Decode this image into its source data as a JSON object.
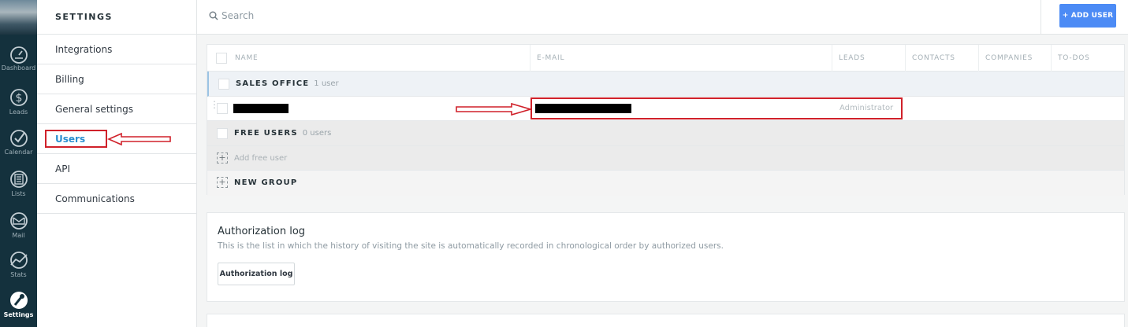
{
  "rail": {
    "items": [
      {
        "label": "Dashboard",
        "icon": "dashboard-icon"
      },
      {
        "label": "Leads",
        "icon": "dollar-icon"
      },
      {
        "label": "Calendar",
        "icon": "check-circle-icon"
      },
      {
        "label": "Lists",
        "icon": "list-icon"
      },
      {
        "label": "Mail",
        "icon": "mail-icon"
      },
      {
        "label": "Stats",
        "icon": "stats-icon"
      },
      {
        "label": "Settings",
        "icon": "wrench-icon"
      }
    ]
  },
  "settings": {
    "header": "SETTINGS",
    "items": [
      {
        "label": "Integrations"
      },
      {
        "label": "Billing"
      },
      {
        "label": "General settings"
      },
      {
        "label": "Users"
      },
      {
        "label": "API"
      },
      {
        "label": "Communications"
      }
    ]
  },
  "topbar": {
    "search_placeholder": "Search",
    "add_user_label": "+ ADD USER"
  },
  "table": {
    "columns": [
      "NAME",
      "E-MAIL",
      "LEADS",
      "CONTACTS",
      "COMPANIES",
      "TO-DOS"
    ],
    "group1": {
      "name": "SALES OFFICE",
      "count": "1 user"
    },
    "user_row": {
      "role": "Administrator"
    },
    "group2": {
      "name": "FREE USERS",
      "count": "0 users"
    },
    "add_free_user": "Add free user",
    "new_group": "NEW GROUP"
  },
  "auth_card": {
    "title": "Authorization log",
    "description": "This is the list in which the history of visiting the site is automatically recorded in chronological order by authorized users.",
    "button": "Authorization log"
  },
  "colors": {
    "rail_bg": "#14313d",
    "accent_blue": "#4c8bf5",
    "active_link": "#2a8fd0",
    "annotation_red": "#d0212a"
  }
}
